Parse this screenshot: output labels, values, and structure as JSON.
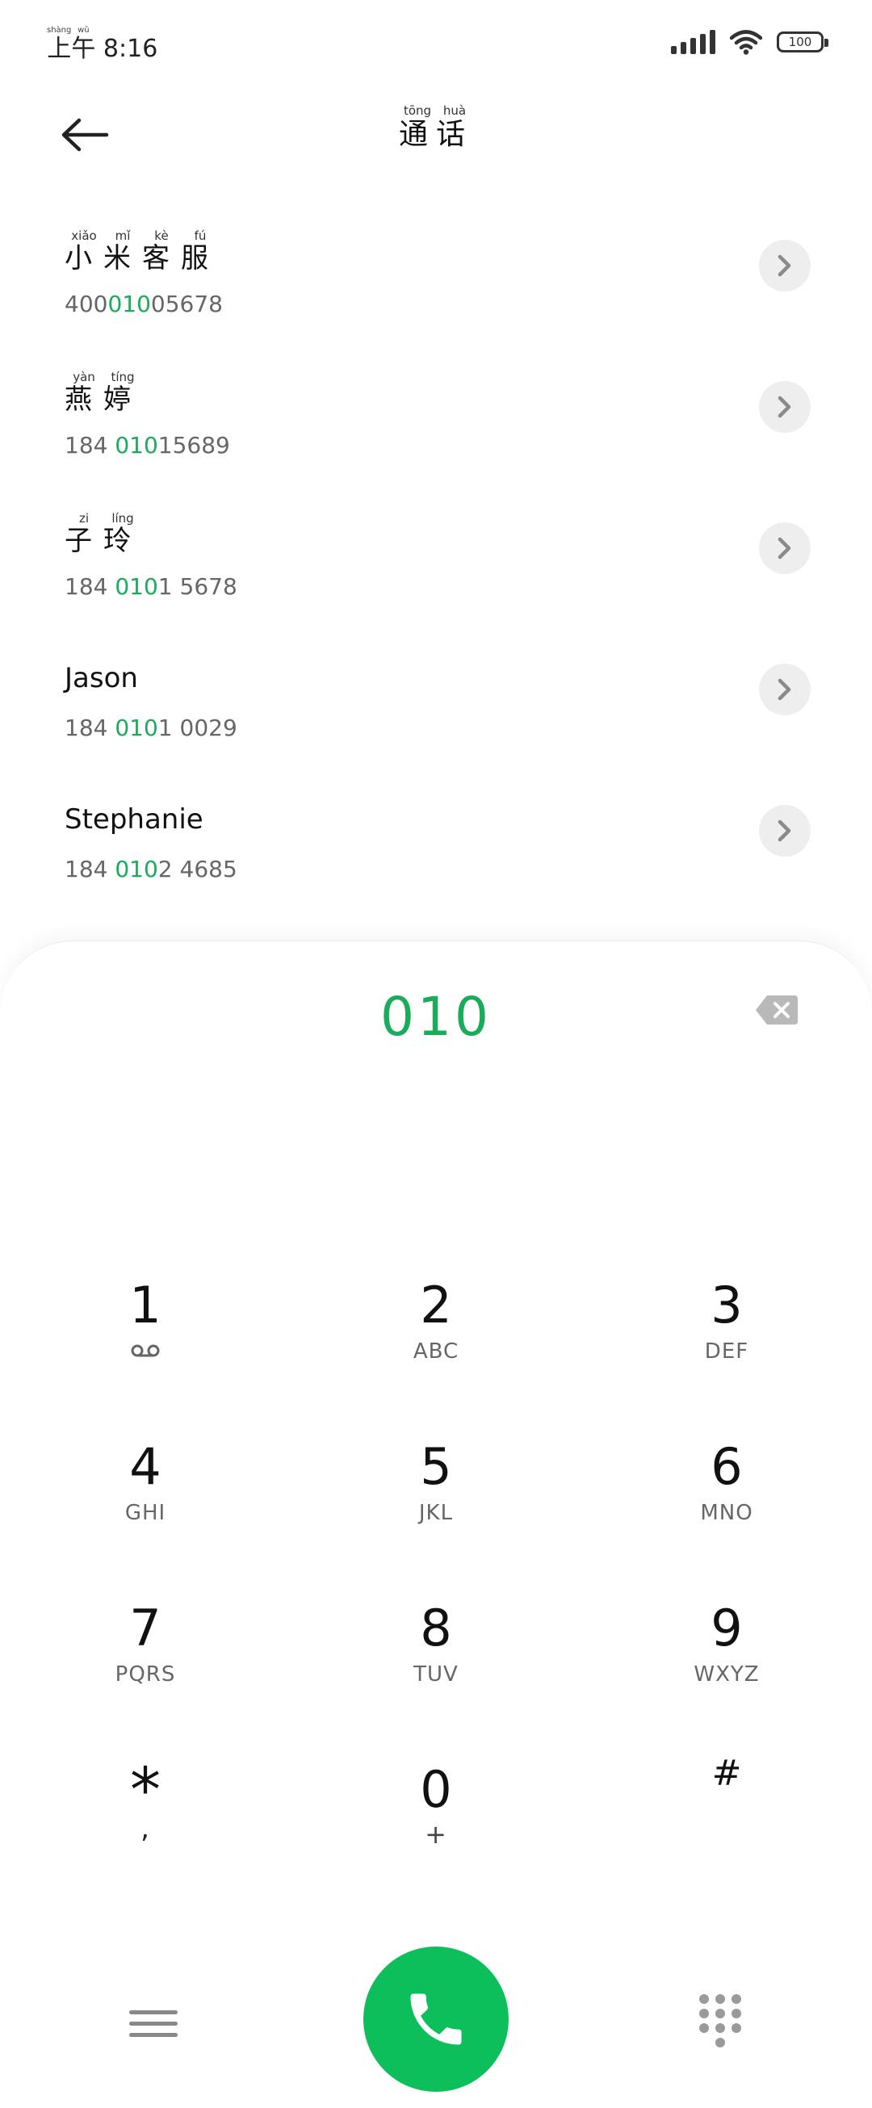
{
  "status_bar": {
    "time_ruby_1": "上",
    "time_ruby_1_pinyin": "shàng",
    "time_ruby_2": "午",
    "time_ruby_2_pinyin": "wǔ",
    "time": "8:16",
    "battery": "100"
  },
  "header": {
    "title_chars": [
      {
        "char": "通",
        "pinyin": "tōng"
      },
      {
        "char": "话",
        "pinyin": "huà"
      }
    ]
  },
  "contacts": [
    {
      "name_chars": [
        {
          "char": "小",
          "pinyin": "xiǎo"
        },
        {
          "char": "米",
          "pinyin": "mǐ"
        },
        {
          "char": "客",
          "pinyin": "kè"
        },
        {
          "char": "服",
          "pinyin": "fú"
        }
      ],
      "number_pre": "400",
      "number_hl": "010",
      "number_post": "05678"
    },
    {
      "name_chars": [
        {
          "char": "燕",
          "pinyin": "yàn"
        },
        {
          "char": "婷",
          "pinyin": "tíng"
        }
      ],
      "number_pre": "184 ",
      "number_hl": "010",
      "number_post": "15689"
    },
    {
      "name_chars": [
        {
          "char": "子",
          "pinyin": "zi"
        },
        {
          "char": "玲",
          "pinyin": "líng"
        }
      ],
      "number_pre": "184 ",
      "number_hl": "010",
      "number_post": "1 5678"
    },
    {
      "name": "Jason",
      "number_pre": "184 ",
      "number_hl": "010",
      "number_post": "1 0029"
    },
    {
      "name": "Stephanie",
      "number_pre": "184 ",
      "number_hl": "010",
      "number_post": "2 4685"
    }
  ],
  "dialer": {
    "input": "010",
    "keys": [
      {
        "digit": "1",
        "letters": ""
      },
      {
        "digit": "2",
        "letters": "ABC"
      },
      {
        "digit": "3",
        "letters": "DEF"
      },
      {
        "digit": "4",
        "letters": "GHI"
      },
      {
        "digit": "5",
        "letters": "JKL"
      },
      {
        "digit": "6",
        "letters": "MNO"
      },
      {
        "digit": "7",
        "letters": "PQRS"
      },
      {
        "digit": "8",
        "letters": "TUV"
      },
      {
        "digit": "9",
        "letters": "WXYZ"
      },
      {
        "digit": "*",
        "letters": ","
      },
      {
        "digit": "0",
        "letters": "+"
      },
      {
        "digit": "#",
        "letters": ""
      }
    ]
  },
  "colors": {
    "accent": "#1aac5a",
    "call_button": "#0dbf5a"
  },
  "icons": {
    "back": "arrow-left-icon",
    "detail": "chevron-right-icon",
    "backspace": "backspace-icon",
    "voicemail": "voicemail-icon",
    "menu": "menu-icon",
    "call": "phone-icon",
    "keypad": "keypad-icon"
  }
}
